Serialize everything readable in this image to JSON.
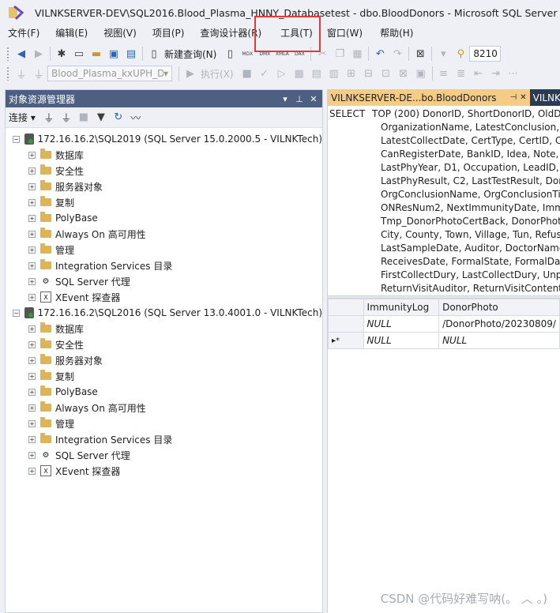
{
  "window": {
    "title": "VILNKSERVER-DEV\\SQL2016.Blood_Plasma_HNNY_Databasetest - dbo.BloodDonors - Microsoft SQL Server Manag"
  },
  "menu": [
    {
      "id": "file",
      "label": "文件(F)"
    },
    {
      "id": "edit",
      "label": "编辑(E)"
    },
    {
      "id": "view",
      "label": "视图(V)"
    },
    {
      "id": "project",
      "label": "项目(P)"
    },
    {
      "id": "query-designer",
      "label": "查询设计器(R)"
    },
    {
      "id": "tools",
      "label": "工具(T)"
    },
    {
      "id": "window",
      "label": "窗口(W)"
    },
    {
      "id": "help",
      "label": "帮助(H)"
    }
  ],
  "toolbar1": {
    "new_query_label": "新建查询(N)",
    "mini_icons": [
      "MDX",
      "DMX",
      "XMLA",
      "DAX"
    ],
    "number_value": "8210"
  },
  "toolbar2": {
    "database_selector": "Blood_Plasma_kxUPH_Da",
    "execute_label": "执行(X)"
  },
  "object_explorer": {
    "title": "对象资源管理器",
    "connect_label": "连接",
    "servers": [
      {
        "name": "172.16.16.2\\SQL2019 (SQL Server 15.0.2000.5 - VILNKTech)",
        "children": [
          {
            "label": "数据库",
            "icon": "folder-icon"
          },
          {
            "label": "安全性",
            "icon": "folder-icon"
          },
          {
            "label": "服务器对象",
            "icon": "folder-icon"
          },
          {
            "label": "复制",
            "icon": "folder-icon"
          },
          {
            "label": "PolyBase",
            "icon": "folder-icon"
          },
          {
            "label": "Always On 高可用性",
            "icon": "folder-icon"
          },
          {
            "label": "管理",
            "icon": "folder-icon"
          },
          {
            "label": "Integration Services 目录",
            "icon": "folder-icon"
          },
          {
            "label": "SQL Server 代理",
            "icon": "agent-icon"
          },
          {
            "label": "XEvent 探查器",
            "icon": "xevent-icon"
          }
        ]
      },
      {
        "name": "172.16.16.2\\SQL2016 (SQL Server 13.0.4001.0 - VILNKTech)",
        "children": [
          {
            "label": "数据库",
            "icon": "folder-icon"
          },
          {
            "label": "安全性",
            "icon": "folder-icon"
          },
          {
            "label": "服务器对象",
            "icon": "folder-icon"
          },
          {
            "label": "复制",
            "icon": "folder-icon"
          },
          {
            "label": "PolyBase",
            "icon": "folder-icon"
          },
          {
            "label": "Always On 高可用性",
            "icon": "folder-icon"
          },
          {
            "label": "管理",
            "icon": "folder-icon"
          },
          {
            "label": "Integration Services 目录",
            "icon": "folder-icon"
          },
          {
            "label": "SQL Server 代理",
            "icon": "agent-icon"
          },
          {
            "label": "XEvent 探查器",
            "icon": "xevent-icon"
          }
        ]
      }
    ]
  },
  "editor": {
    "active_tab": "VILNKSERVER-DE...bo.BloodDonors",
    "inactive_tab": "VILNK",
    "sql_keyword": "SELECT",
    "sql_lines": [
      "TOP (200) DonorID, ShortDonorID, OldDo",
      "OrganizationName, LatestConclusion, A",
      "LatestCollectDate, CertType, CertID, Cer",
      "CanRegisterDate, BankID, Idea, Note, R",
      "LastPhyYear, D1, Occupation, LeadID, w",
      "LastPhyResult, C2, LastTestResult, Dono",
      "OrgConclusionName, OrgConclusionTin",
      "ONResNum2, NextImmunityDate, Immu",
      "Tmp_DonorPhotoCertBack, DonorPhoto",
      "City, County, Town, Village, Tun, Refusel",
      "LastSampleDate, Auditor, DoctorName,",
      "ReceivesDate, FormalState, FormalDate,",
      "FirstCollectDury, LastCollectDury, Unpas",
      "ReturnVisitAuditor, ReturnVisitContent, A"
    ],
    "grid": {
      "columns": [
        "ImmunityLog",
        "DonorPhoto"
      ],
      "rows": [
        {
          "marker": "",
          "cells": [
            "NULL",
            "/DonorPhoto/20230809/"
          ]
        },
        {
          "marker": "▸*",
          "cells": [
            "NULL",
            "NULL"
          ]
        }
      ]
    }
  },
  "watermark": "CSDN @代码好难写呐(。 ︎︿ 。)",
  "colors": {
    "highlight": "#e53935",
    "panel_header": "#4d6082",
    "active_tab": "#f5cc84"
  }
}
